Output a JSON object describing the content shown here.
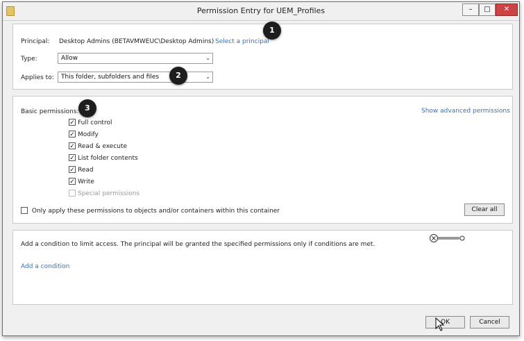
{
  "window": {
    "title": "Permission Entry for UEM_Profiles",
    "min_glyph": "–",
    "max_glyph": "□",
    "close_glyph": "✕"
  },
  "principal": {
    "label": "Principal:",
    "value": "Desktop Admins (BETAVMWEUC\\Desktop Admins)",
    "select_link": "Select a principal"
  },
  "type": {
    "label": "Type:",
    "value": "Allow"
  },
  "applies_to": {
    "label": "Applies to:",
    "value": "This folder, subfolders and files"
  },
  "permissions": {
    "label": "Basic permissions:",
    "advanced_link": "Show advanced permissions",
    "items": [
      {
        "label": "Full control",
        "checked": true,
        "enabled": true
      },
      {
        "label": "Modify",
        "checked": true,
        "enabled": true
      },
      {
        "label": "Read & execute",
        "checked": true,
        "enabled": true
      },
      {
        "label": "List folder contents",
        "checked": true,
        "enabled": true
      },
      {
        "label": "Read",
        "checked": true,
        "enabled": true
      },
      {
        "label": "Write",
        "checked": true,
        "enabled": true
      },
      {
        "label": "Special permissions",
        "checked": false,
        "enabled": false
      }
    ],
    "only_apply_label": "Only apply these permissions to objects and/or containers within this container",
    "only_apply_checked": false,
    "clear_all": "Clear all"
  },
  "condition": {
    "text": "Add a condition to limit access. The principal will be granted the specified permissions only if conditions are met.",
    "add_link": "Add a condition"
  },
  "buttons": {
    "ok": "OK",
    "cancel": "Cancel"
  },
  "badges": [
    "1",
    "2",
    "3"
  ],
  "colors": {
    "link": "#2f73c4",
    "badge": "#1d1d1d",
    "close": "#c44444"
  }
}
